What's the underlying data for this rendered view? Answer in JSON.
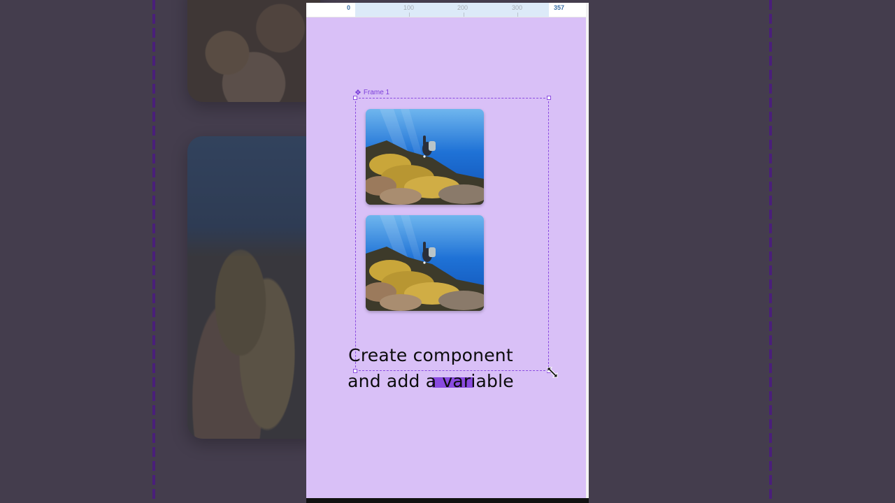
{
  "ruler": {
    "labels": [
      "0",
      "100",
      "200",
      "300",
      "357"
    ]
  },
  "frame": {
    "name": "Frame 1",
    "icon": "component-icon",
    "accent_color": "#8a4be0"
  },
  "images": [
    {
      "name": "underwater-diver-photo-1"
    },
    {
      "name": "underwater-diver-photo-2"
    }
  ],
  "caption": {
    "line1": "Create component",
    "line2": "and add a variable"
  },
  "colors": {
    "canvas": "#d9c0f7",
    "background": "#443d4d",
    "selection": "#8a4be0"
  }
}
